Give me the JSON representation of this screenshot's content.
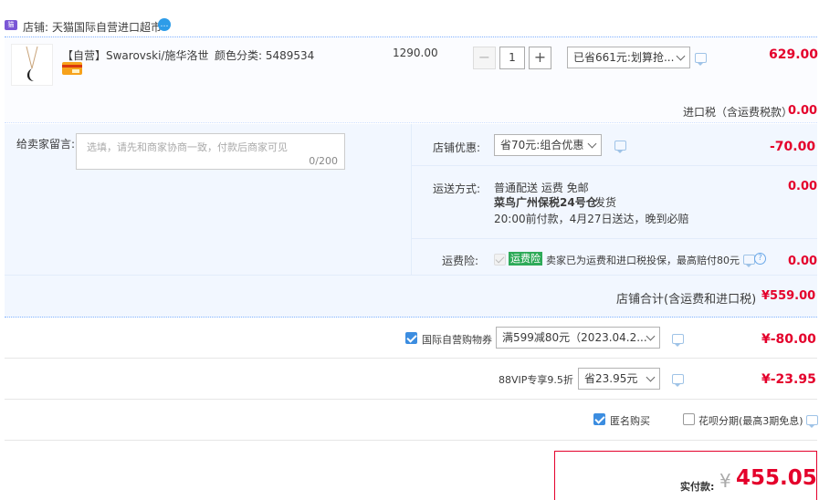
{
  "shop": {
    "prefix": "店铺:",
    "name": "天猫国际自营进口超市"
  },
  "item": {
    "title": "【自营】Swarovski/施华洛世...",
    "spec": "颜色分类: 5489534",
    "price": "1290.00",
    "qty": "1",
    "discount_select": "已省661元:划算抢...",
    "subtotal": "629.00"
  },
  "import_tax": {
    "label": "进口税（含运费税款）",
    "value": "0.00"
  },
  "message": {
    "label": "给卖家留言:",
    "placeholder": "选填，请先和商家协商一致，付款后商家可见",
    "counter": "0/200"
  },
  "shop_discount": {
    "label": "店铺优惠:",
    "select": "省70元:组合优惠",
    "value": "-70.00"
  },
  "shipping": {
    "label": "运送方式:",
    "line1": "普通配送 运费 免邮",
    "line2_bold": "菜鸟广州保税24号仓",
    "line2_rest": "发货",
    "line3": "20:00前付款，4月27日送达，晚到必赔",
    "value": "0.00"
  },
  "insurance": {
    "label": "运费险:",
    "badge": "运费险",
    "text": "卖家已为运费和进口税投保，最高赔付80元",
    "value": "0.00"
  },
  "shop_total": {
    "label": "店铺合计(含运费和进口税)",
    "value": "¥559.00"
  },
  "coupon": {
    "label": "国际自营购物券",
    "select": "满599减80元（2023.04.2...",
    "value": "¥-80.00"
  },
  "vip": {
    "label": "88VIP专享9.5折",
    "select": "省23.95元",
    "value": "¥-23.95"
  },
  "options": {
    "anonymous": "匿名购买",
    "installment": "花呗分期(最高3期免息)"
  },
  "pay": {
    "label": "实付款:",
    "currency": "¥",
    "amount": "455.05"
  },
  "colors": {
    "accent": "#e4002b",
    "panel": "#f2f7ff",
    "border": "#b2d1ff"
  }
}
